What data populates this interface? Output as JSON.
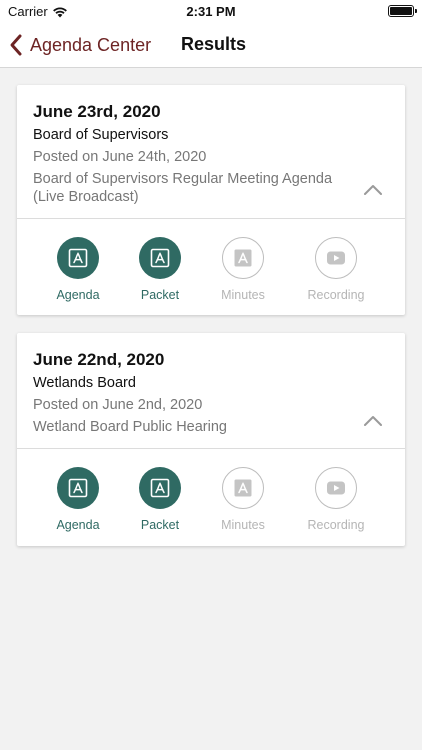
{
  "status_bar": {
    "carrier": "Carrier",
    "time": "2:31 PM"
  },
  "nav": {
    "back_label": "Agenda Center",
    "title": "Results"
  },
  "colors": {
    "accent_back": "#6d2424",
    "action_active": "#2f6a63",
    "action_inactive": "#b5b5b5"
  },
  "results": [
    {
      "date": "June 23rd, 2020",
      "board": "Board of Supervisors",
      "posted": "Posted on June 24th, 2020",
      "description": "Board of Supervisors Regular Meeting Agenda (Live Broadcast)",
      "actions": [
        {
          "label": "Agenda",
          "icon": "pdf-icon",
          "active": true
        },
        {
          "label": "Packet",
          "icon": "pdf-icon",
          "active": true
        },
        {
          "label": "Minutes",
          "icon": "pdf-icon",
          "active": false
        },
        {
          "label": "Recording",
          "icon": "play-video-icon",
          "active": false
        }
      ]
    },
    {
      "date": "June 22nd, 2020",
      "board": "Wetlands Board",
      "posted": "Posted on June 2nd, 2020",
      "description": "Wetland Board Public Hearing",
      "actions": [
        {
          "label": "Agenda",
          "icon": "pdf-icon",
          "active": true
        },
        {
          "label": "Packet",
          "icon": "pdf-icon",
          "active": true
        },
        {
          "label": "Minutes",
          "icon": "pdf-icon",
          "active": false
        },
        {
          "label": "Recording",
          "icon": "play-video-icon",
          "active": false
        }
      ]
    }
  ]
}
